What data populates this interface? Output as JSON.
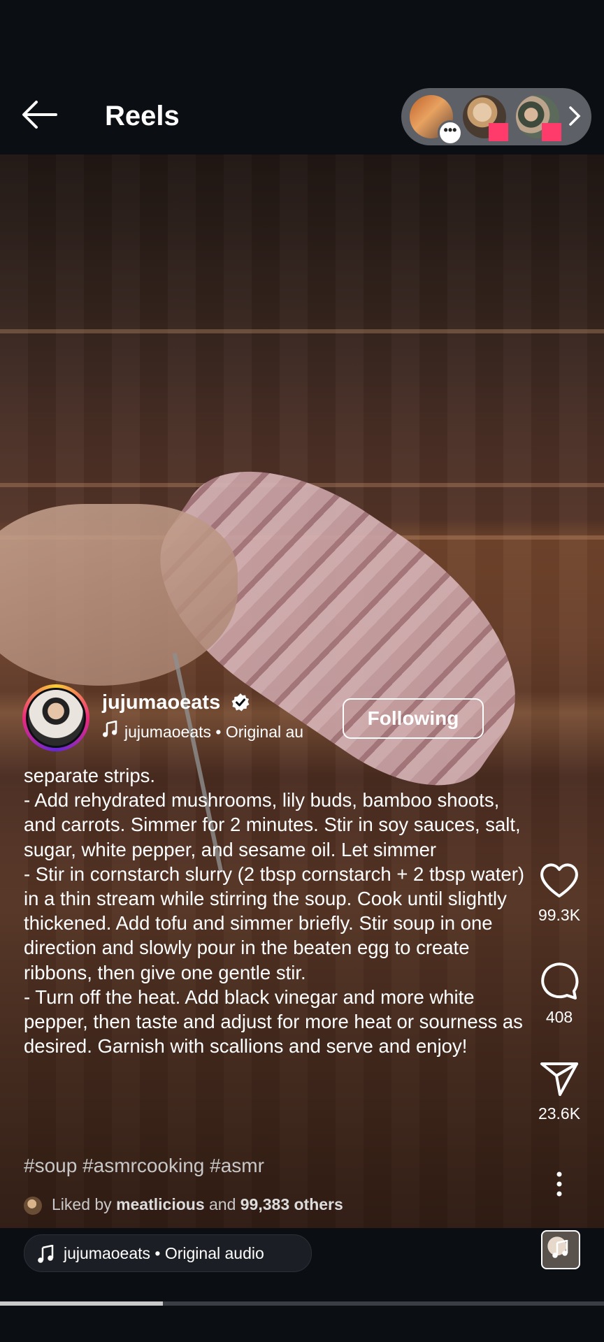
{
  "header": {
    "title": "Reels"
  },
  "author": {
    "username": "jujumaoeats",
    "audio_line": "jujumaoeats • Original au",
    "follow_label": "Following"
  },
  "caption": "separate strips.\n- Add rehydrated mushrooms, lily buds, bamboo shoots, and carrots. Simmer for 2 minutes. Stir in soy sauces, salt, sugar, white pepper, and sesame oil. Let simmer\n- Stir in cornstarch slurry (2 tbsp cornstarch + 2 tbsp water) in a thin stream while stirring the soup. Cook until slightly thickened. Add tofu and simmer briefly. Stir soup in one direction and slowly pour in the beaten egg to create ribbons, then give one gentle stir.\n- Turn off the heat. Add black vinegar and more white pepper, then taste and adjust for more heat or sourness as desired. Garnish with scallions and serve and enjoy!",
  "hashtags": "#soup #asmrcooking #asmr",
  "liked": {
    "prefix": "Liked by",
    "user": "meatlicious",
    "middle": "and",
    "others": "99,383 others"
  },
  "actions": {
    "likes": "99.3K",
    "comments": "408",
    "shares": "23.6K"
  },
  "audio_pill": "jujumaoeats • Original audio",
  "progress": 0.27,
  "icons": {
    "back": "arrow-left-icon",
    "like": "heart-icon",
    "comment": "comment-icon",
    "share": "send-icon",
    "more": "more-vertical-icon",
    "music": "music-note-icon",
    "verified": "verified-badge-icon"
  }
}
